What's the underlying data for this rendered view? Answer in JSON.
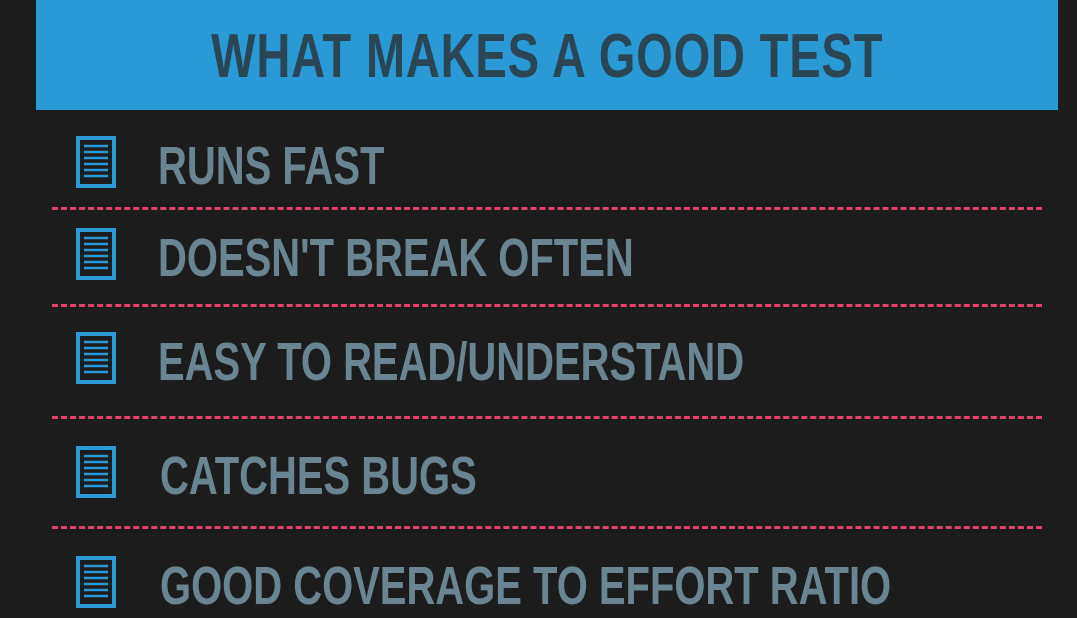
{
  "header": {
    "title": "WHAT MAKES A GOOD TEST"
  },
  "items": [
    {
      "label": "RUNS FAST",
      "icon": "document-list-icon"
    },
    {
      "label": "DOESN'T BREAK OFTEN",
      "icon": "document-list-icon"
    },
    {
      "label": "EASY TO READ/UNDERSTAND",
      "icon": "document-list-icon"
    },
    {
      "label": "CATCHES BUGS",
      "icon": "document-list-icon"
    },
    {
      "label": "GOOD COVERAGE TO EFFORT RATIO",
      "icon": "document-list-icon"
    }
  ],
  "colors": {
    "background": "#1c1c1c",
    "header_bg": "#2a9ad6",
    "header_text": "#2a4655",
    "item_text": "#6a8591",
    "icon": "#2a9ad6",
    "divider": "#e0406a"
  }
}
